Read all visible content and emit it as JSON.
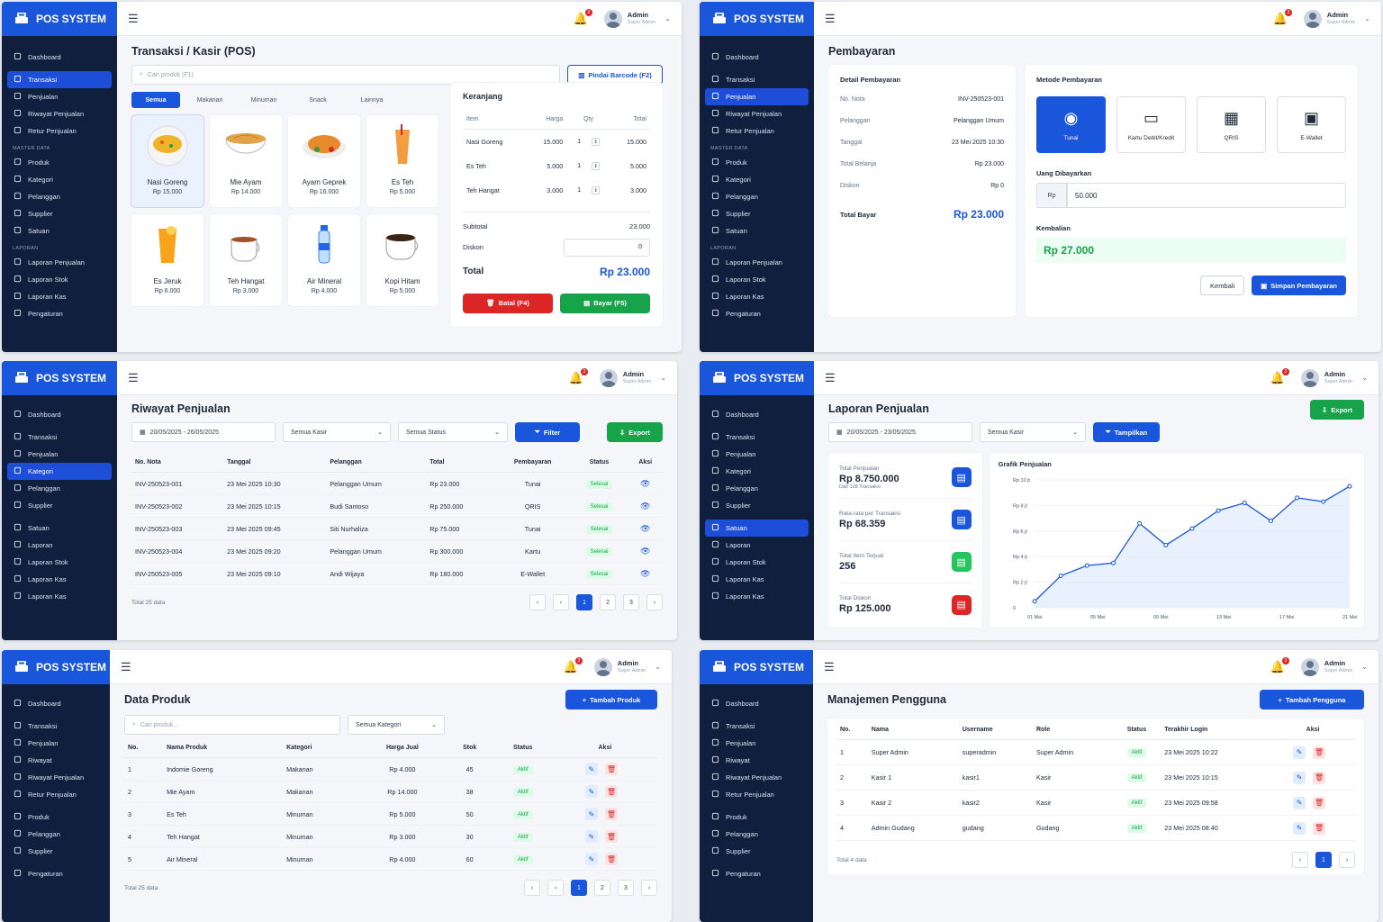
{
  "app": {
    "brand": "POS SYSTEM",
    "user_name": "Admin",
    "user_role": "Super Admin",
    "notif_count": "3"
  },
  "sidebar1": {
    "items_a": [
      {
        "label": "Dashboard"
      }
    ],
    "items_b": [
      {
        "label": "Transaksi"
      },
      {
        "label": "Penjualan"
      },
      {
        "label": "Riwayat Penjualan"
      },
      {
        "label": "Retur Penjualan"
      }
    ],
    "sec_master": "MASTER DATA",
    "items_c": [
      {
        "label": "Produk"
      },
      {
        "label": "Kategori"
      },
      {
        "label": "Pelanggan"
      },
      {
        "label": "Supplier"
      },
      {
        "label": "Satuan"
      }
    ],
    "sec_laporan": "LAPORAN",
    "items_d": [
      {
        "label": "Laporan Penjualan"
      },
      {
        "label": "Laporan Stok"
      },
      {
        "label": "Laporan Kas"
      },
      {
        "label": "Pengaturan"
      }
    ]
  },
  "kasir": {
    "title_a": "Transaksi",
    "title_sep": "/",
    "title_b": "Kasir (POS)",
    "search_placeholder": "Cari produk (F1)",
    "scan_label": "Pindai Barcode (F2)",
    "tabs": [
      {
        "label": "Semua"
      },
      {
        "label": "Makanan"
      },
      {
        "label": "Minuman"
      },
      {
        "label": "Snack"
      },
      {
        "label": "Lainnya"
      }
    ],
    "products": [
      {
        "name": "Nasi Goreng",
        "price": "Rp 15.000"
      },
      {
        "name": "Mie Ayam",
        "price": "Rp 14.000"
      },
      {
        "name": "Ayam Geprek",
        "price": "Rp 16.000"
      },
      {
        "name": "Es Teh",
        "price": "Rp 5.000"
      },
      {
        "name": "Es Jeruk",
        "price": "Rp 6.000"
      },
      {
        "name": "Teh Hangat",
        "price": "Rp 3.000"
      },
      {
        "name": "Air Mineral",
        "price": "Rp 4.000"
      },
      {
        "name": "Kopi Hitam",
        "price": "Rp 5.000"
      }
    ],
    "cart_title": "Keranjang",
    "cart_headers": {
      "item": "Item",
      "harga": "Harga",
      "qty": "Qty",
      "total": "Total"
    },
    "cart_rows": [
      {
        "item": "Nasi Goreng",
        "harga": "15.000",
        "qty": "1",
        "total": "15.000"
      },
      {
        "item": "Es Teh",
        "harga": "5.000",
        "qty": "1",
        "total": "5.000"
      },
      {
        "item": "Teh Hangat",
        "harga": "3.000",
        "qty": "1",
        "total": "3.000"
      }
    ],
    "subtotal_label": "Subtotal",
    "subtotal": "23.000",
    "diskon_label": "Diskon",
    "diskon": "0",
    "total_label": "Total",
    "total": "Rp 23.000",
    "cancel_label": "Batal (F4)",
    "pay_label": "Bayar (F5)"
  },
  "bayar": {
    "title": "Pembayaran",
    "detail_title": "Detail Pembayaran",
    "rows": [
      {
        "k": "No. Nota",
        "v": "INV-250523-001"
      },
      {
        "k": "Pelanggan",
        "v": "Pelanggan Umum"
      },
      {
        "k": "Tanggal",
        "v": "23 Mei 2025 10:30"
      },
      {
        "k": "Total Belanja",
        "v": "Rp 23.000"
      },
      {
        "k": "Diskon",
        "v": "Rp 0"
      }
    ],
    "total_k": "Total Bayar",
    "total_v": "Rp 23.000",
    "metode_title": "Metode Pembayaran",
    "methods": [
      {
        "label": "Tunai"
      },
      {
        "label": "Kartu Debit/Kredit"
      },
      {
        "label": "QRIS"
      },
      {
        "label": "E-Wallet"
      }
    ],
    "uang_label": "Uang Dibayarkan",
    "rp": "Rp",
    "uang_value": "50.000",
    "kembali_label": "Kembalian",
    "kembali_value": "Rp 27.000",
    "back_label": "Kembali",
    "save_label": "Simpan Pembayaran"
  },
  "riwayat": {
    "title": "Riwayat Penjualan",
    "date_range": "20/05/2025 - 26/05/2025",
    "kasir_sel": "Semua Kasir",
    "status_sel": "Semua Status",
    "filter_label": "Filter",
    "export_label": "Export",
    "headers": {
      "nota": "No. Nota",
      "tgl": "Tanggal",
      "plg": "Pelanggan",
      "total": "Total",
      "bayar": "Pembayaran",
      "status": "Status",
      "aksi": "Aksi"
    },
    "rows": [
      {
        "nota": "INV-250523-001",
        "tgl": "23 Mei 2025 10:30",
        "plg": "Pelanggan Umum",
        "total": "Rp 23.000",
        "bayar": "Tunai",
        "status": "Selesai"
      },
      {
        "nota": "INV-250523-002",
        "tgl": "23 Mei 2025 10:15",
        "plg": "Budi Santoso",
        "total": "Rp 250.000",
        "bayar": "QRIS",
        "status": "Selesai"
      },
      {
        "nota": "INV-250523-003",
        "tgl": "23 Mei 2025 09:45",
        "plg": "Siti Nurhaliza",
        "total": "Rp 75.000",
        "bayar": "Tunai",
        "status": "Selesai"
      },
      {
        "nota": "INV-250523-004",
        "tgl": "23 Mei 2025 09:20",
        "plg": "Pelanggan Umum",
        "total": "Rp 300.000",
        "bayar": "Kartu",
        "status": "Selesai"
      },
      {
        "nota": "INV-250523-005",
        "tgl": "23 Mei 2025 09:10",
        "plg": "Andi Wijaya",
        "total": "Rp 180.000",
        "bayar": "E-Wallet",
        "status": "Selesai"
      }
    ],
    "total_data": "Total 25 data",
    "pages": [
      "1",
      "2",
      "3"
    ]
  },
  "sidebar3": {
    "items": [
      {
        "label": "Dashboard"
      },
      {
        "label": "Transaksi"
      },
      {
        "label": "Penjualan"
      },
      {
        "label": "Kategori"
      },
      {
        "label": "Pelanggan"
      },
      {
        "label": "Supplier"
      },
      {
        "label": "Satuan"
      },
      {
        "label": "Laporan"
      },
      {
        "label": "Laporan Stok"
      },
      {
        "label": "Laporan Kas"
      },
      {
        "label": "Laporan Kas"
      }
    ]
  },
  "laporan": {
    "title": "Laporan Penjualan",
    "export_label": "Export",
    "date_range": "20/05/2025 - 23/05/2025",
    "kasir_sel": "Semua Kasir",
    "show_label": "Tampilkan",
    "stats": [
      {
        "label": "Total Penjualan",
        "value": "Rp 8.750.000",
        "sub": "Dari 128 Transaksi",
        "color": "#1a56db"
      },
      {
        "label": "Rata-rata per Transaksi",
        "value": "Rp 68.359",
        "sub": "",
        "color": "#1a56db"
      },
      {
        "label": "Total Item Terjual",
        "value": "256",
        "sub": "",
        "color": "#22c55e"
      },
      {
        "label": "Total Diskon",
        "value": "Rp 125.000",
        "sub": "",
        "color": "#dc2626"
      }
    ],
    "chart_title": "Grafik Penjualan"
  },
  "chart_data": {
    "type": "area",
    "title": "Grafik Penjualan",
    "y_ticks": [
      "Rp 10 jt",
      "Rp 8 jt",
      "Rp 6 jt",
      "Rp 4 jt",
      "Rp 2 jt",
      "0"
    ],
    "x_ticks": [
      "01 Mei",
      "05 Mei",
      "09 Mei",
      "13 Mei",
      "17 Mei",
      "21 Mei"
    ],
    "ylim": [
      0,
      10
    ],
    "values": [
      0.5,
      2.5,
      3.3,
      3.5,
      6.6,
      4.9,
      6.2,
      7.6,
      8.2,
      6.8,
      8.6,
      8.3,
      9.5
    ],
    "color": "#1a56db"
  },
  "produk": {
    "title": "Data Produk",
    "add_label": "Tambah Produk",
    "search_placeholder": "Cari produk...",
    "kategori_sel": "Semua Kategori",
    "headers": {
      "no": "No.",
      "nama": "Nama Produk",
      "kat": "Kategori",
      "harga": "Harga Jual",
      "stok": "Stok",
      "status": "Status",
      "aksi": "Aksi"
    },
    "rows": [
      {
        "no": "1",
        "nama": "Indomie Goreng",
        "kat": "Makanan",
        "harga": "Rp 4.000",
        "stok": "45",
        "status": "Aktif"
      },
      {
        "no": "2",
        "nama": "Mie Ayam",
        "kat": "Makanan",
        "harga": "Rp 14.000",
        "stok": "38",
        "status": "Aktif"
      },
      {
        "no": "3",
        "nama": "Es Teh",
        "kat": "Minuman",
        "harga": "Rp 5.000",
        "stok": "50",
        "status": "Aktif"
      },
      {
        "no": "4",
        "nama": "Teh Hangat",
        "kat": "Minuman",
        "harga": "Rp 3.000",
        "stok": "30",
        "status": "Aktif"
      },
      {
        "no": "5",
        "nama": "Air Mineral",
        "kat": "Minuman",
        "harga": "Rp 4.000",
        "stok": "60",
        "status": "Aktif"
      }
    ],
    "total_data": "Total 25 data",
    "pages": [
      "1",
      "2",
      "3"
    ]
  },
  "sidebar5": {
    "items": [
      {
        "label": "Dashboard"
      },
      {
        "label": "Transaksi"
      },
      {
        "label": "Penjualan"
      },
      {
        "label": "Riwayat"
      },
      {
        "label": "Riwayat Penjualan"
      },
      {
        "label": "Retur Penjualan"
      },
      {
        "label": "Produk"
      },
      {
        "label": "Pelanggan"
      },
      {
        "label": "Supplier"
      },
      {
        "label": "Pengaturan"
      }
    ]
  },
  "pengguna": {
    "title": "Manajemen Pengguna",
    "add_label": "Tambah Pengguna",
    "headers": {
      "no": "No.",
      "nama": "Nama",
      "user": "Username",
      "role": "Role",
      "status": "Status",
      "login": "Terakhir Login",
      "aksi": "Aksi"
    },
    "rows": [
      {
        "no": "1",
        "nama": "Super Admin",
        "user": "superadmin",
        "role": "Super Admin",
        "status": "Aktif",
        "login": "23 Mei 2025 10:22"
      },
      {
        "no": "2",
        "nama": "Kasir 1",
        "user": "kasir1",
        "role": "Kasir",
        "status": "Aktif",
        "login": "23 Mei 2025 10:15"
      },
      {
        "no": "3",
        "nama": "Kasir 2",
        "user": "kasir2",
        "role": "Kasir",
        "status": "Aktif",
        "login": "23 Mei 2025 09:58"
      },
      {
        "no": "4",
        "nama": "Admin Gudang",
        "user": "gudang",
        "role": "Gudang",
        "status": "Aktif",
        "login": "23 Mei 2025 08:40"
      }
    ],
    "total_data": "Total 4 data",
    "pages": [
      "1"
    ]
  }
}
